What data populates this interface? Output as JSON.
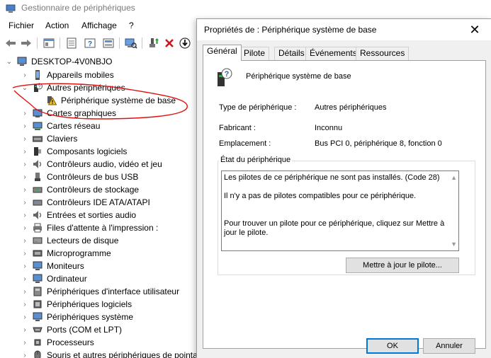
{
  "window": {
    "title": "Gestionnaire de périphériques",
    "menu": [
      "Fichier",
      "Action",
      "Affichage",
      "?"
    ]
  },
  "toolbar": {
    "icons": [
      "back-arrow-icon",
      "forward-arrow-icon",
      "properties-icon",
      "driver-icon",
      "help-icon",
      "show-hidden-icon",
      "scan-hardware-icon",
      "update-driver-icon",
      "uninstall-icon",
      "disable-icon"
    ]
  },
  "tree": {
    "root": "DESKTOP-4V0NBJO",
    "items": [
      {
        "label": "Appareils mobiles"
      },
      {
        "label": "Autres périphériques"
      },
      {
        "label": "Périphérique système de base"
      },
      {
        "label": "Cartes graphiques"
      },
      {
        "label": "Cartes réseau"
      },
      {
        "label": "Claviers"
      },
      {
        "label": "Composants logiciels"
      },
      {
        "label": "Contrôleurs audio, vidéo et jeu"
      },
      {
        "label": "Contrôleurs de bus USB"
      },
      {
        "label": "Contrôleurs de stockage"
      },
      {
        "label": "Contrôleurs IDE ATA/ATAPI"
      },
      {
        "label": "Entrées et sorties audio"
      },
      {
        "label": "Files d'attente à l'impression :"
      },
      {
        "label": "Lecteurs de disque"
      },
      {
        "label": "Microprogramme"
      },
      {
        "label": "Moniteurs"
      },
      {
        "label": "Ordinateur"
      },
      {
        "label": "Périphériques d'interface utilisateur"
      },
      {
        "label": "Périphériques logiciels"
      },
      {
        "label": "Périphériques système"
      },
      {
        "label": "Ports (COM et LPT)"
      },
      {
        "label": "Processeurs"
      },
      {
        "label": "Souris et autres périphériques de pointage"
      }
    ]
  },
  "dialog": {
    "title": "Propriétés de : Périphérique système de base",
    "tabs": [
      "Général",
      "Pilote",
      "Détails",
      "Événements",
      "Ressources"
    ],
    "device_name": "Périphérique système de base",
    "props": {
      "type_label": "Type de périphérique :",
      "type_value": "Autres périphériques",
      "maker_label": "Fabricant :",
      "maker_value": "Inconnu",
      "location_label": "Emplacement :",
      "location_value": "Bus PCI 0, périphérique 8, fonction 0"
    },
    "status_label": "État du périphérique",
    "status_text": "Les pilotes de ce périphérique ne sont pas installés. (Code 28)\n\nIl n'y a pas de pilotes compatibles pour ce périphérique.\n\n\nPour trouver un pilote pour ce périphérique, cliquez sur Mettre à jour le pilote.",
    "update_button": "Mettre à jour le pilote...",
    "ok_button": "OK",
    "cancel_button": "Annuler"
  }
}
